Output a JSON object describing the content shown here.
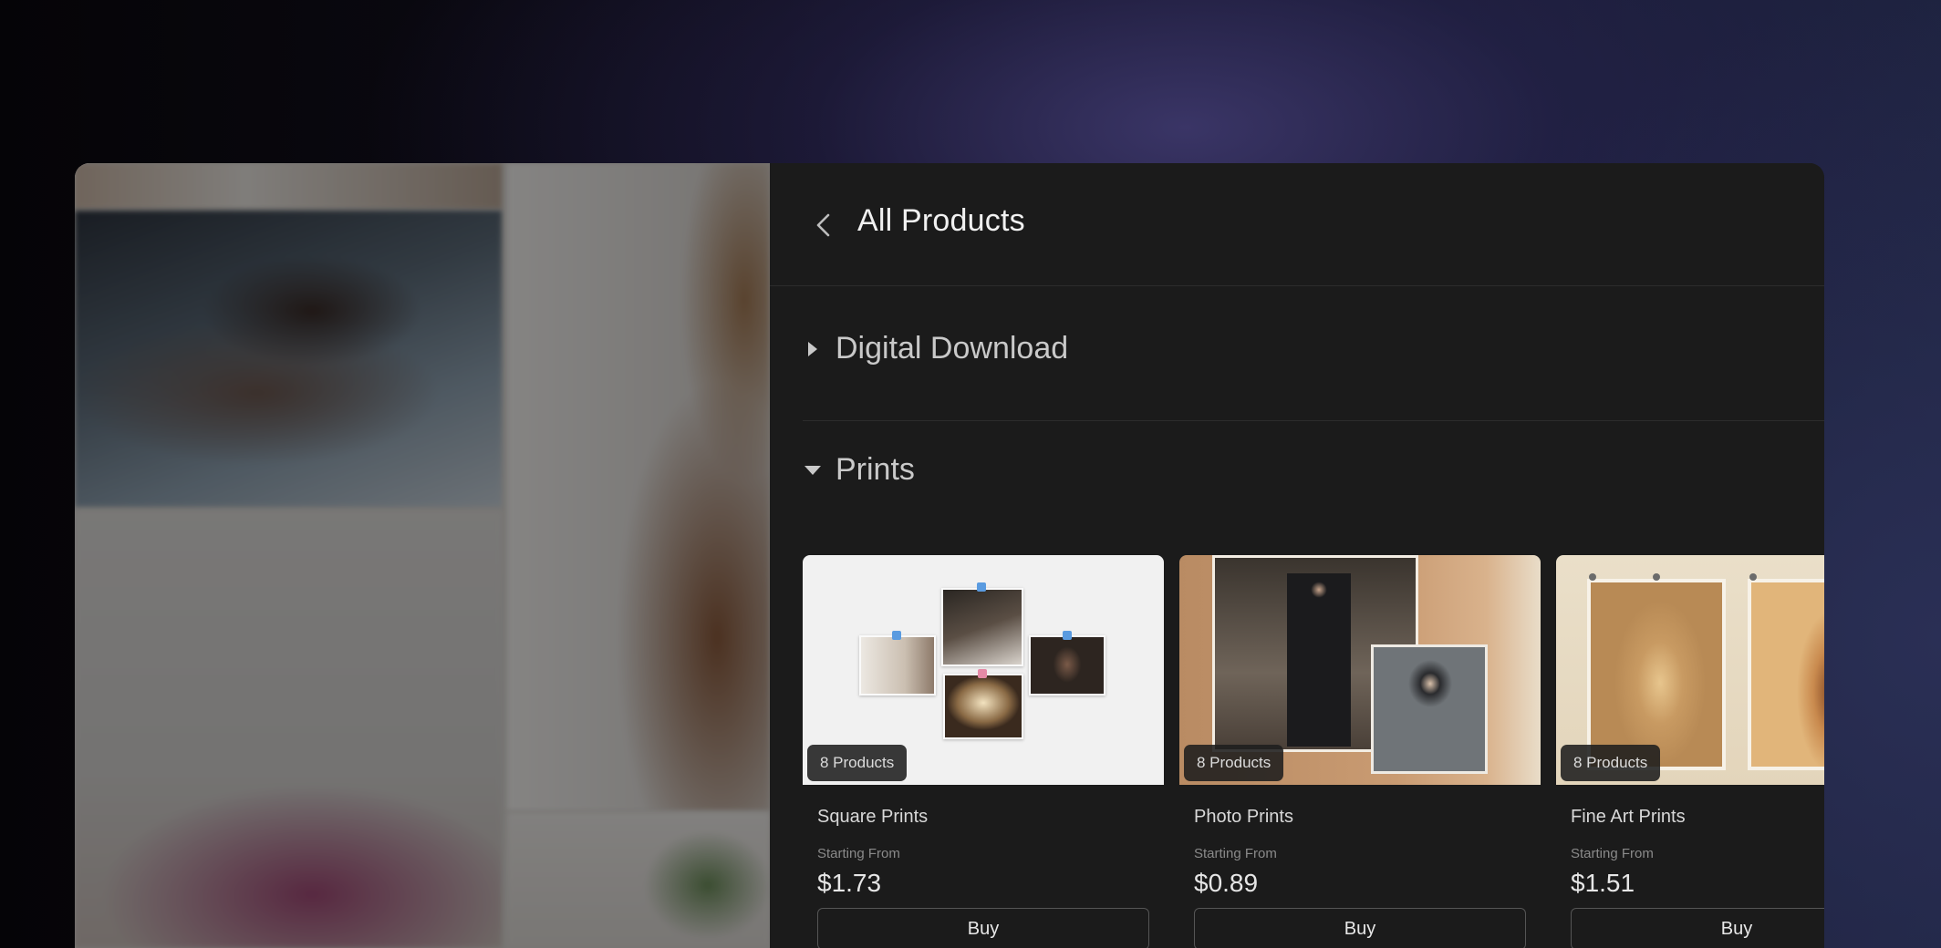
{
  "header": {
    "title": "All Products"
  },
  "sections": {
    "digital": {
      "label": "Digital Download",
      "expanded": false
    },
    "prints": {
      "label": "Prints",
      "expanded": true
    }
  },
  "cards": [
    {
      "name": "Square Prints",
      "badge": "8 Products",
      "starting_label": "Starting From",
      "price": "$1.73",
      "buy_label": "Buy"
    },
    {
      "name": "Photo Prints",
      "badge": "8 Products",
      "starting_label": "Starting From",
      "price": "$0.89",
      "buy_label": "Buy"
    },
    {
      "name": "Fine Art Prints",
      "badge": "8 Products",
      "starting_label": "Starting From",
      "price": "$1.51",
      "buy_label": "Buy"
    }
  ],
  "colors": {
    "panel_bg": "#1b1b1b",
    "title_text": "#f1f1f1",
    "section_text": "#c9c9c9",
    "button_border": "#555555"
  }
}
